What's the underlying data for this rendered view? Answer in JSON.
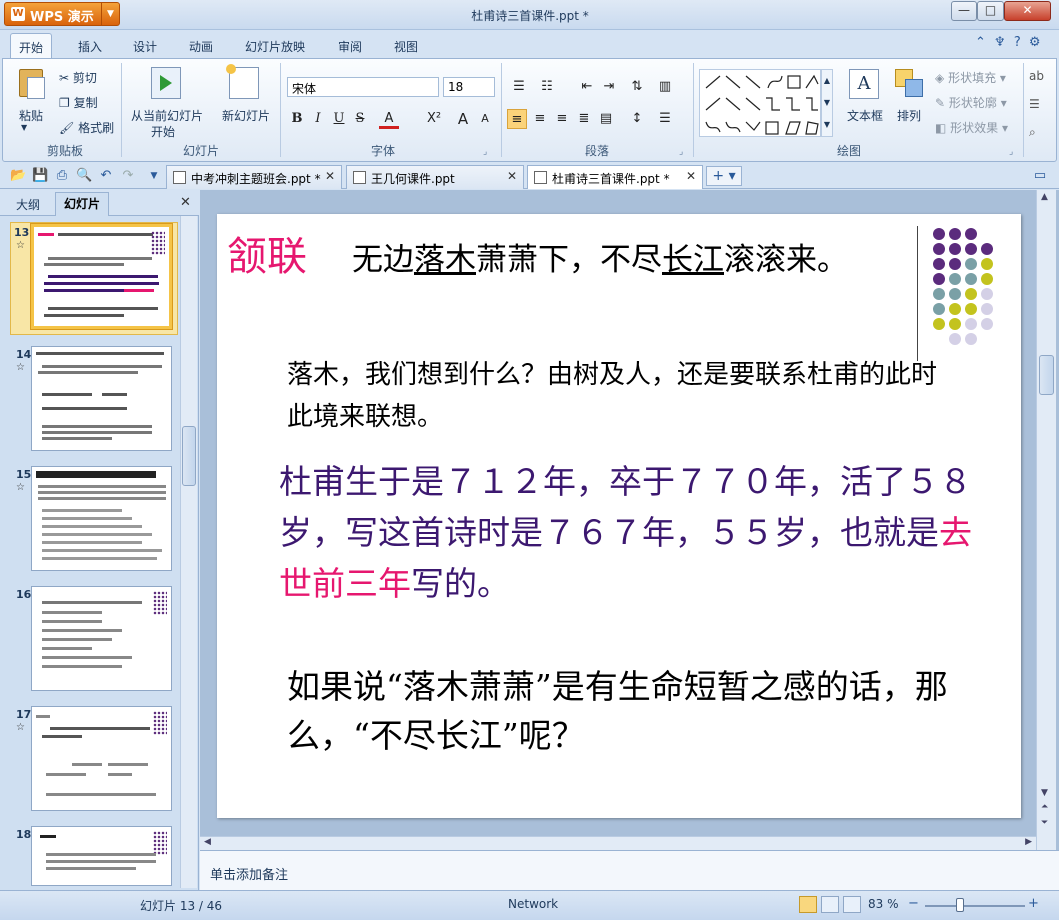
{
  "app": {
    "name": "WPS 演示",
    "window_title": "杜甫诗三首课件.ppt *"
  },
  "window_buttons": {
    "minimize": "—",
    "maximize": "□",
    "close": "✕"
  },
  "menu_tabs": [
    "开始",
    "插入",
    "设计",
    "动画",
    "幻灯片放映",
    "审阅",
    "视图"
  ],
  "ribbon": {
    "clipboard": {
      "paste": "粘贴",
      "cut": "剪切",
      "copy": "复制",
      "format_painter": "格式刷",
      "group": "剪贴板"
    },
    "slides": {
      "from_current_1": "从当前幻灯片",
      "from_current_2": "开始",
      "new_slide": "新幻灯片",
      "group": "幻灯片"
    },
    "font": {
      "name": "宋体",
      "size": "18",
      "bold": "B",
      "italic": "I",
      "underline": "U",
      "strike": "S",
      "color": "A",
      "superscript": "X²",
      "grow": "A",
      "shrink": "A",
      "group": "字体"
    },
    "paragraph": {
      "group": "段落"
    },
    "drawing": {
      "textbox": "文本框",
      "arrange": "排列",
      "shape_fill": "形状填充",
      "shape_outline": "形状轮廓",
      "shape_effect": "形状效果",
      "group": "绘图"
    }
  },
  "doc_tabs": [
    {
      "label": "中考冲刺主题班会.ppt *",
      "close": "✕"
    },
    {
      "label": "王几何课件.ppt",
      "close": "✕"
    },
    {
      "label": "杜甫诗三首课件.ppt *",
      "close": "✕"
    }
  ],
  "left_pane": {
    "tab_outline": "大纲",
    "tab_slides": "幻灯片",
    "close": "✕"
  },
  "thumbnails": [
    {
      "num": "13",
      "star": "☆"
    },
    {
      "num": "14",
      "star": "☆"
    },
    {
      "num": "15",
      "star": "☆"
    },
    {
      "num": "16",
      "star": ""
    },
    {
      "num": "17",
      "star": "☆"
    },
    {
      "num": "18",
      "star": ""
    }
  ],
  "slide": {
    "title": "颔联",
    "line1_a": "无边",
    "line1_b": "落木",
    "line1_c": "萧萧下，不尽",
    "line1_d": "长江",
    "line1_e": "滚滚来。",
    "p2": "落木，我们想到什么？由树及人，还是要联系杜甫的此时此境来联想。",
    "p3_a": "杜甫生于是７１２年，卒于７７０年，活了５８岁，写这首诗时是７６７年，５５岁，也就是",
    "p3_b": "去世前三年",
    "p3_c": "写的。",
    "p4": "如果说“落木萧萧”是有生命短暂之感的话，那么，“不尽长江”呢？",
    "accent_color": "#e6176f",
    "text_color_purple": "#3c1870"
  },
  "notes_placeholder": "单击添加备注",
  "status": {
    "slide_info": "幻灯片 13 / 46",
    "network": "Network",
    "zoom": "83 %",
    "zoom_minus": "−",
    "zoom_plus": "+"
  }
}
